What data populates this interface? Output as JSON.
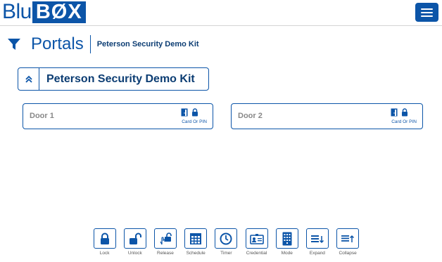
{
  "app": {
    "logo_part1": "Blu",
    "logo_part2": "BØX"
  },
  "header": {
    "title": "Portals",
    "site": "Peterson Security Demo Kit"
  },
  "group": {
    "title": "Peterson Security Demo Kit"
  },
  "doors": [
    {
      "name": "Door 1",
      "mode": "Card Or PIN",
      "status_icons": [
        "door-closed-icon",
        "lock-icon"
      ]
    },
    {
      "name": "Door 2",
      "mode": "Card Or PIN",
      "status_icons": [
        "door-closed-icon",
        "lock-icon"
      ]
    }
  ],
  "toolbar": [
    {
      "label": "Lock",
      "icon": "lock-icon"
    },
    {
      "label": "Unlock",
      "icon": "unlock-icon"
    },
    {
      "label": "Release",
      "icon": "release-icon"
    },
    {
      "label": "Schedule",
      "icon": "schedule-icon"
    },
    {
      "label": "Timer",
      "icon": "timer-icon"
    },
    {
      "label": "Credential",
      "icon": "credential-icon"
    },
    {
      "label": "Mode",
      "icon": "keypad-icon"
    },
    {
      "label": "Expand",
      "icon": "expand-icon"
    },
    {
      "label": "Collapse",
      "icon": "collapse-icon"
    }
  ],
  "colors": {
    "brand": "#0c55a8",
    "dark_text": "#0c3d73",
    "muted_text": "#888888"
  }
}
